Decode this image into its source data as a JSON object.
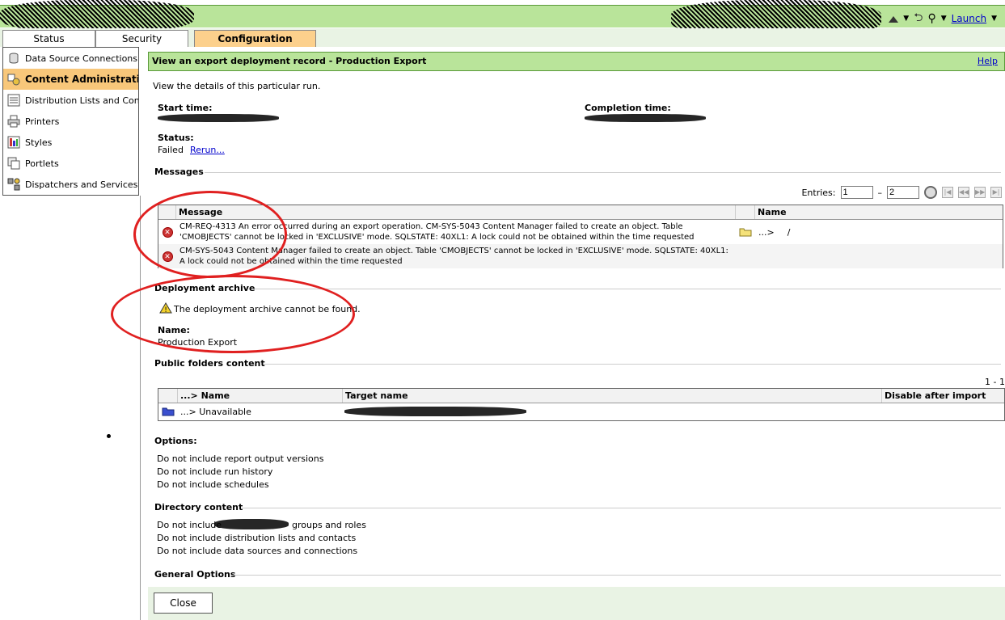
{
  "top": {
    "launch_label": "Launch"
  },
  "tabs": [
    {
      "label": "Status"
    },
    {
      "label": "Security"
    },
    {
      "label": "Configuration"
    }
  ],
  "sidebar": {
    "items": [
      {
        "label": "Data Source Connections",
        "icon": "database-icon"
      },
      {
        "label": "Content Administration",
        "icon": "content-admin-icon"
      },
      {
        "label": "Distribution Lists and Contacts",
        "icon": "distribution-list-icon"
      },
      {
        "label": "Printers",
        "icon": "printer-icon"
      },
      {
        "label": "Styles",
        "icon": "styles-icon"
      },
      {
        "label": "Portlets",
        "icon": "portlets-icon"
      },
      {
        "label": "Dispatchers and Services",
        "icon": "dispatchers-icon"
      }
    ]
  },
  "page": {
    "title": "View an export deployment record - Production Export",
    "help": "Help",
    "description": "View the details of this particular run.",
    "start_time_label": "Start time:",
    "completion_time_label": "Completion time:",
    "status_label": "Status:",
    "status_value": "Failed",
    "rerun": "Rerun..."
  },
  "messages": {
    "section_title": "Messages",
    "entries_label": "Entries:",
    "entries_from": "1",
    "entries_dash": "–",
    "entries_to": "2",
    "col_message": "Message",
    "col_name": "Name",
    "rows": [
      {
        "text": "CM-REQ-4313 An error occurred during an export operation. CM-SYS-5043 Content Manager failed to create an object. Table 'CMOBJECTS' cannot be locked in 'EXCLUSIVE' mode. SQLSTATE: 40XL1: A lock could not be obtained within the time requested",
        "name_prefix": "...>",
        "name": "/"
      },
      {
        "text": "CM-SYS-5043 Content Manager failed to create an object. Table 'CMOBJECTS' cannot be locked in 'EXCLUSIVE' mode. SQLSTATE: 40XL1: A lock could not be obtained within the time requested",
        "name_prefix": "",
        "name": ""
      }
    ]
  },
  "archive": {
    "section_title": "Deployment archive",
    "warning": "The deployment archive cannot be found.",
    "name_label": "Name:",
    "name_value": "Production Export"
  },
  "public_folders": {
    "section_title": "Public folders content",
    "pager": "1 - 1",
    "col_name": "...> Name",
    "col_target": "Target name",
    "col_disable": "Disable after import",
    "row_name": "...> Unavailable"
  },
  "options": {
    "section_title": "Options:",
    "items": [
      "Do not include report output versions",
      "Do not include run history",
      "Do not include schedules"
    ]
  },
  "directory": {
    "section_title": "Directory content",
    "items": [
      "Do not include",
      "groups and roles",
      "Do not include distribution lists and contacts",
      "Do not include data sources and connections"
    ]
  },
  "general": {
    "section_title": "General Options"
  },
  "footer": {
    "close": "Close"
  },
  "colors": {
    "header_green": "#b9e49a",
    "active_orange": "#fcd08c",
    "annotation_red": "#e02020"
  }
}
